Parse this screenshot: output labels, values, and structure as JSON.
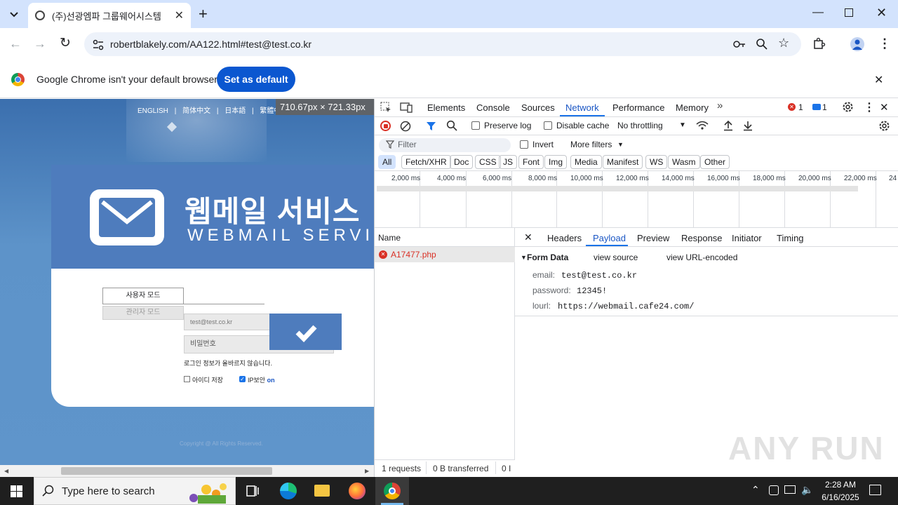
{
  "browser": {
    "tab_title": "(주)선광엠파 그룹웨어시스템",
    "new_tab": "+",
    "url": "robertblakely.com/AA122.html#test@test.co.kr",
    "infobar_text": "Google Chrome isn't your default browser",
    "set_default_label": "Set as default"
  },
  "webpage": {
    "lang_links": [
      "ENGLISH",
      "简体中文",
      "日本語",
      "繁體中文"
    ],
    "dimension_tooltip": "710.67px × 721.33px",
    "title_korean": "웹메일 서비스",
    "title_english": "WEBMAIL SERVICE",
    "mode_user": "사용자 모드",
    "mode_admin": "관리자 모드",
    "id_value": "test@test.co.kr",
    "password_placeholder": "비밀번호",
    "error_message": "로그인 정보가 올바르지 않습니다.",
    "save_id_label": "아이디 저장",
    "ip_security_label": "IP보안",
    "ip_security_state": "on",
    "copyright": "Copyright @ All Rights Reserved."
  },
  "devtools": {
    "tabs": [
      "Elements",
      "Console",
      "Sources",
      "Network",
      "Performance",
      "Memory"
    ],
    "active_tab": "Network",
    "error_count": "1",
    "message_count": "1",
    "preserve_log": "Preserve log",
    "disable_cache": "Disable cache",
    "throttling": "No throttling",
    "filter_placeholder": "Filter",
    "invert": "Invert",
    "more_filters": "More filters",
    "type_filters": [
      "All",
      "Fetch/XHR",
      "Doc",
      "CSS",
      "JS",
      "Font",
      "Img",
      "Media",
      "Manifest",
      "WS",
      "Wasm",
      "Other"
    ],
    "timeline_ticks": [
      "2,000 ms",
      "4,000 ms",
      "6,000 ms",
      "8,000 ms",
      "10,000 ms",
      "12,000 ms",
      "14,000 ms",
      "16,000 ms",
      "18,000 ms",
      "20,000 ms",
      "22,000 ms",
      "24"
    ],
    "name_header": "Name",
    "requests": [
      {
        "name": "A17477.php",
        "status": "error"
      }
    ],
    "detail_tabs": [
      "Headers",
      "Payload",
      "Preview",
      "Response",
      "Initiator",
      "Timing"
    ],
    "active_detail_tab": "Payload",
    "form_data_title": "Form Data",
    "view_source": "view source",
    "view_url_encoded": "view URL-encoded",
    "form_fields": [
      {
        "key": "email:",
        "value": "test@test.co.kr"
      },
      {
        "key": "password:",
        "value": "12345!"
      },
      {
        "key": "lourl:",
        "value": "https://webmail.cafe24.com/"
      }
    ],
    "status_requests": "1 requests",
    "status_transferred": "0 B transferred",
    "status_extra": "0 I"
  },
  "taskbar": {
    "search_placeholder": "Type here to search",
    "time": "2:28 AM",
    "date": "6/16/2025"
  },
  "watermark": "ANY RUN",
  "colors": {
    "chrome_blue": "#0b57d0",
    "tabstrip": "#d3e3fd",
    "banner_blue": "#4e7cbd",
    "error_red": "#d93025"
  }
}
